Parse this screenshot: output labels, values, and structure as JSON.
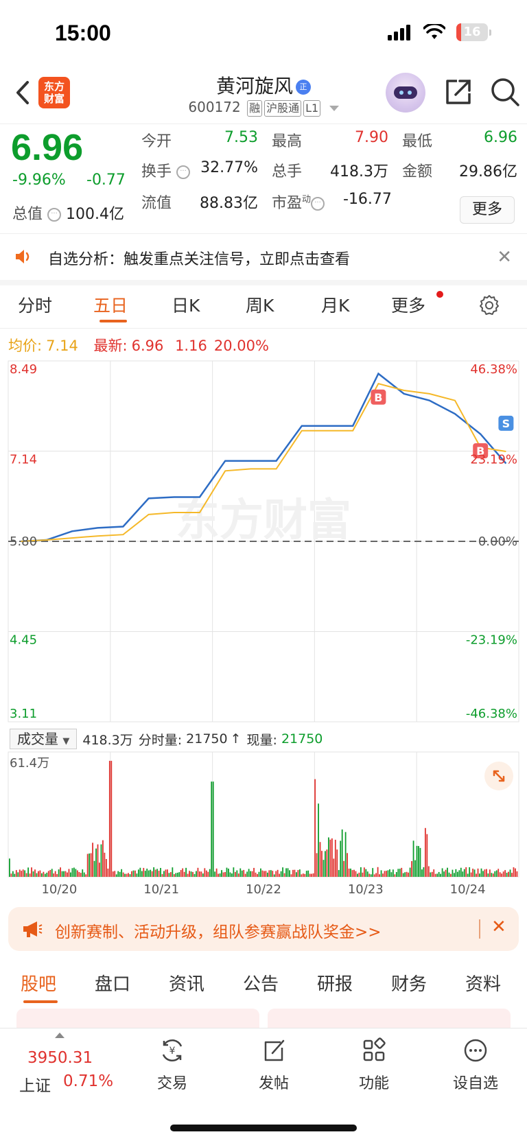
{
  "status_bar": {
    "time": "15:00",
    "battery": "16",
    "battery_level": 0.16
  },
  "header": {
    "logo_line1": "东方",
    "logo_line2": "财富",
    "stock_name": "黄河旋风",
    "name_badge": "正",
    "stock_code": "600172",
    "tags": [
      "融",
      "沪股通",
      "L1"
    ]
  },
  "quote": {
    "price": "6.96",
    "change_pct": "-9.96%",
    "change": "-0.77",
    "total_value_label": "总值",
    "total_value": "100.4亿",
    "rows": [
      [
        {
          "label": "今开",
          "value": "7.53",
          "color": "green"
        },
        {
          "label": "最高",
          "value": "7.90",
          "color": "red"
        },
        {
          "label": "最低",
          "value": "6.96",
          "color": "green"
        }
      ],
      [
        {
          "label": "换手",
          "value": "32.77%",
          "color": "default"
        },
        {
          "label": "总手",
          "value": "418.3万",
          "color": "default"
        },
        {
          "label": "金额",
          "value": "29.86亿",
          "color": "default"
        }
      ],
      [
        {
          "label": "流值",
          "value": "88.83亿",
          "color": "default"
        },
        {
          "label": "市盈",
          "sup": "动",
          "value": "-16.77",
          "color": "default"
        }
      ]
    ],
    "more_label": "更多"
  },
  "notice": {
    "text": "自选分析：触发重点关注信号，立即点击查看"
  },
  "tabs": [
    "分时",
    "五日",
    "日K",
    "周K",
    "月K",
    "更多"
  ],
  "active_tab": 1,
  "info": {
    "avg_label": "均价:",
    "avg_value": "7.14",
    "latest_label": "最新:",
    "latest_value": "6.96",
    "change_value": "1.16",
    "change_pct": "20.00%"
  },
  "chart_data": {
    "type": "line",
    "dates": [
      "10/20",
      "10/21",
      "10/22",
      "10/23",
      "10/24"
    ],
    "y_left_labels": [
      "8.49",
      "7.14",
      "5.80",
      "4.45",
      "3.11"
    ],
    "y_right_labels": [
      "46.38%",
      "23.19%",
      "0.00%",
      "-23.19%",
      "-46.38%"
    ],
    "ylim": [
      3.11,
      8.49
    ],
    "prev_close": 5.8,
    "series": [
      {
        "values": [
          5.8,
          5.82,
          5.95,
          6.0,
          6.02,
          6.44,
          6.46,
          6.46,
          7.0,
          7.0,
          7.0,
          7.52,
          7.52,
          7.52,
          8.3,
          8.0,
          7.9,
          7.7,
          7.4,
          6.96
        ]
      },
      {
        "values": [
          5.8,
          5.82,
          5.85,
          5.88,
          5.9,
          6.2,
          6.23,
          6.23,
          6.85,
          6.88,
          6.88,
          7.45,
          7.45,
          7.45,
          8.15,
          8.05,
          8.0,
          7.9,
          7.2,
          7.14
        ]
      }
    ],
    "markers": [
      {
        "label": "B"
      },
      {
        "label": "B"
      },
      {
        "label": "S"
      }
    ]
  },
  "volume": {
    "select_label": "成交量",
    "total": "418.3万",
    "interval_label": "分时量:",
    "interval_value": "21750",
    "current_label": "现量:",
    "current_value": "21750",
    "max_label": "61.4万"
  },
  "promo": {
    "text": "创新赛制、活动升级，组队参赛赢战队奖金>>"
  },
  "bottom_tabs": [
    "股吧",
    "盘口",
    "资讯",
    "公告",
    "研报",
    "财务",
    "资料"
  ],
  "bottom_bar": {
    "index_value": "3950.31",
    "index_name": "上证",
    "index_pct": "0.71%",
    "items": [
      {
        "label": "交易",
        "icon": "yuan-cycle-icon"
      },
      {
        "label": "发帖",
        "icon": "edit-icon"
      },
      {
        "label": "功能",
        "icon": "grid-icon"
      },
      {
        "label": "设自选",
        "icon": "more-circle-icon"
      }
    ]
  },
  "colors": {
    "up": "#e0322e",
    "down": "#0d9d2c",
    "accent": "#e8631e",
    "price_line": "#2d6cc4",
    "avg_line": "#f5b828"
  }
}
